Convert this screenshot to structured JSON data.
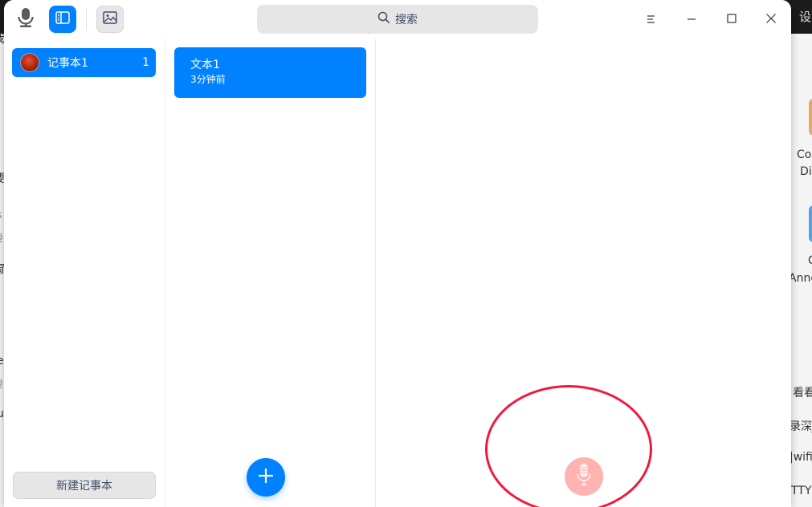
{
  "background_app": {
    "top_right_glyph": "设",
    "fragments_left": [
      "我",
      "要",
      "s",
      "要",
      "窗",
      "e",
      "要",
      "u",
      "i"
    ],
    "fragments_right": [
      "Co",
      "Di",
      "C",
      "Anno",
      "看看",
      "录深J",
      "|wifi",
      "TTY"
    ]
  },
  "toolbar": {
    "search_placeholder": "搜索",
    "icons": [
      "microphone-icon",
      "sidebar-icon",
      "image-icon",
      "search-icon",
      "menu-icon",
      "minimize-icon",
      "maximize-icon",
      "close-icon"
    ]
  },
  "notebooks": {
    "items": [
      {
        "name": "记事本1",
        "count": "1"
      }
    ],
    "new_button_label": "新建记事本"
  },
  "notes": {
    "items": [
      {
        "title": "文本1",
        "time": "3分钟前"
      }
    ],
    "add_icon": "plus-icon"
  },
  "editor": {
    "record_icon": "microphone-icon"
  },
  "colors": {
    "accent": "#0081ff",
    "record_button": "#ffb3b0",
    "highlight": "#ee1b3f"
  }
}
